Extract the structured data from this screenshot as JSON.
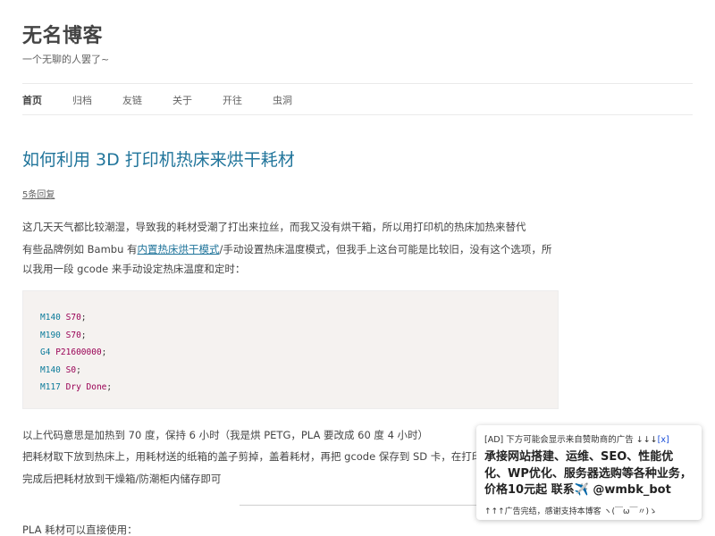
{
  "site": {
    "title": "无名博客",
    "description": "一个无聊的人罢了~"
  },
  "nav": [
    {
      "label": "首页",
      "active": true
    },
    {
      "label": "归档",
      "active": false
    },
    {
      "label": "友链",
      "active": false
    },
    {
      "label": "关于",
      "active": false
    },
    {
      "label": "开往",
      "active": false
    },
    {
      "label": "虫洞",
      "active": false
    }
  ],
  "post": {
    "title": "如何利用 3D 打印机热床来烘干耗材",
    "comments": "5条回复",
    "p1": "这几天天气都比较潮湿，导致我的耗材受潮了打出来拉丝，而我又没有烘干箱，所以用打印机的热床加热来替代",
    "p2_before": "有些品牌例如 Bambu 有",
    "p2_link": "内置热床烘干模式",
    "p2_after": "/手动设置热床温度模式，但我手上这台可能是比较旧，没有这个选项，所以我用一段 gcode 来手动设定热床温度和定时：",
    "code": [
      {
        "cmd": "M140",
        "arg": "S70",
        "suffix": ";"
      },
      {
        "cmd": "M190",
        "arg": "S70",
        "suffix": ";"
      },
      {
        "cmd": "G4",
        "arg": "P21600000",
        "suffix": ";"
      },
      {
        "cmd": "M140",
        "arg": "S0",
        "suffix": ";"
      },
      {
        "cmd": "M117",
        "arg": "Dry Done",
        "suffix": ";"
      }
    ],
    "p3": "以上代码意思是加热到 70 度，保持 6 小时（我是烘 PETG，PLA 要改成 60 度 4 小时）",
    "p4": "把耗材取下放到热床上，用耗材送的纸箱的盖子剪掉，盖着耗材，再把 gcode 保存到 SD 卡，在打印机里",
    "p5": "完成后把耗材放到干燥箱/防潮柜内储存即可",
    "p6": "PLA 耗材可以直接使用："
  },
  "ad": {
    "header": "[AD] 下方可能会显示来自赞助商的广告 ↓↓↓",
    "close": "[x]",
    "body": "承接网站搭建、运维、SEO、性能优化、WP优化、服务器选购等各种业务，价格10元起 联系✈️ @wmbk_bot",
    "footer": "↑↑↑广告完结，感谢支持本博客 ヽ(￣ω￣〃)ゝ"
  },
  "colors": {
    "link": "#21759b",
    "code_bg": "#f5f2f0"
  }
}
